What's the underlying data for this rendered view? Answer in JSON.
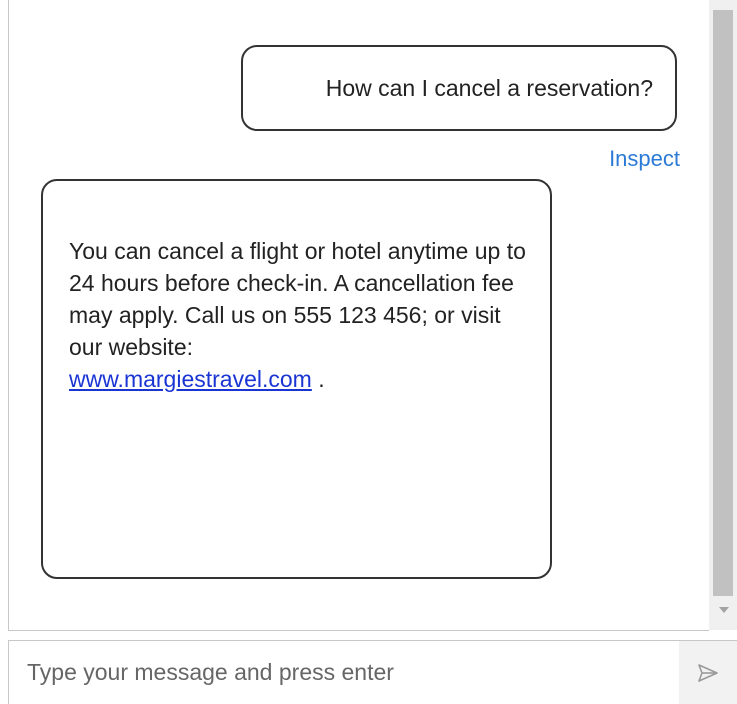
{
  "transcript": {
    "user_message": "How can I cancel a reservation?",
    "inspect_label": "Inspect",
    "bot_message": {
      "text": "You can cancel a flight or hotel anytime up to 24 hours before check-in. A cancellation fee may apply. Call us on 555 123 456; or visit our website:",
      "link_text": "www.margiestravel.com",
      "trailing_text": " ."
    }
  },
  "composer": {
    "placeholder": "Type your message and press enter",
    "send_icon": "send-arrow-icon"
  },
  "colors": {
    "link": "#1a35d4",
    "inspect": "#2b7bd6",
    "bubble_border": "#333333",
    "scrollbar_thumb": "#c1c1c1"
  }
}
